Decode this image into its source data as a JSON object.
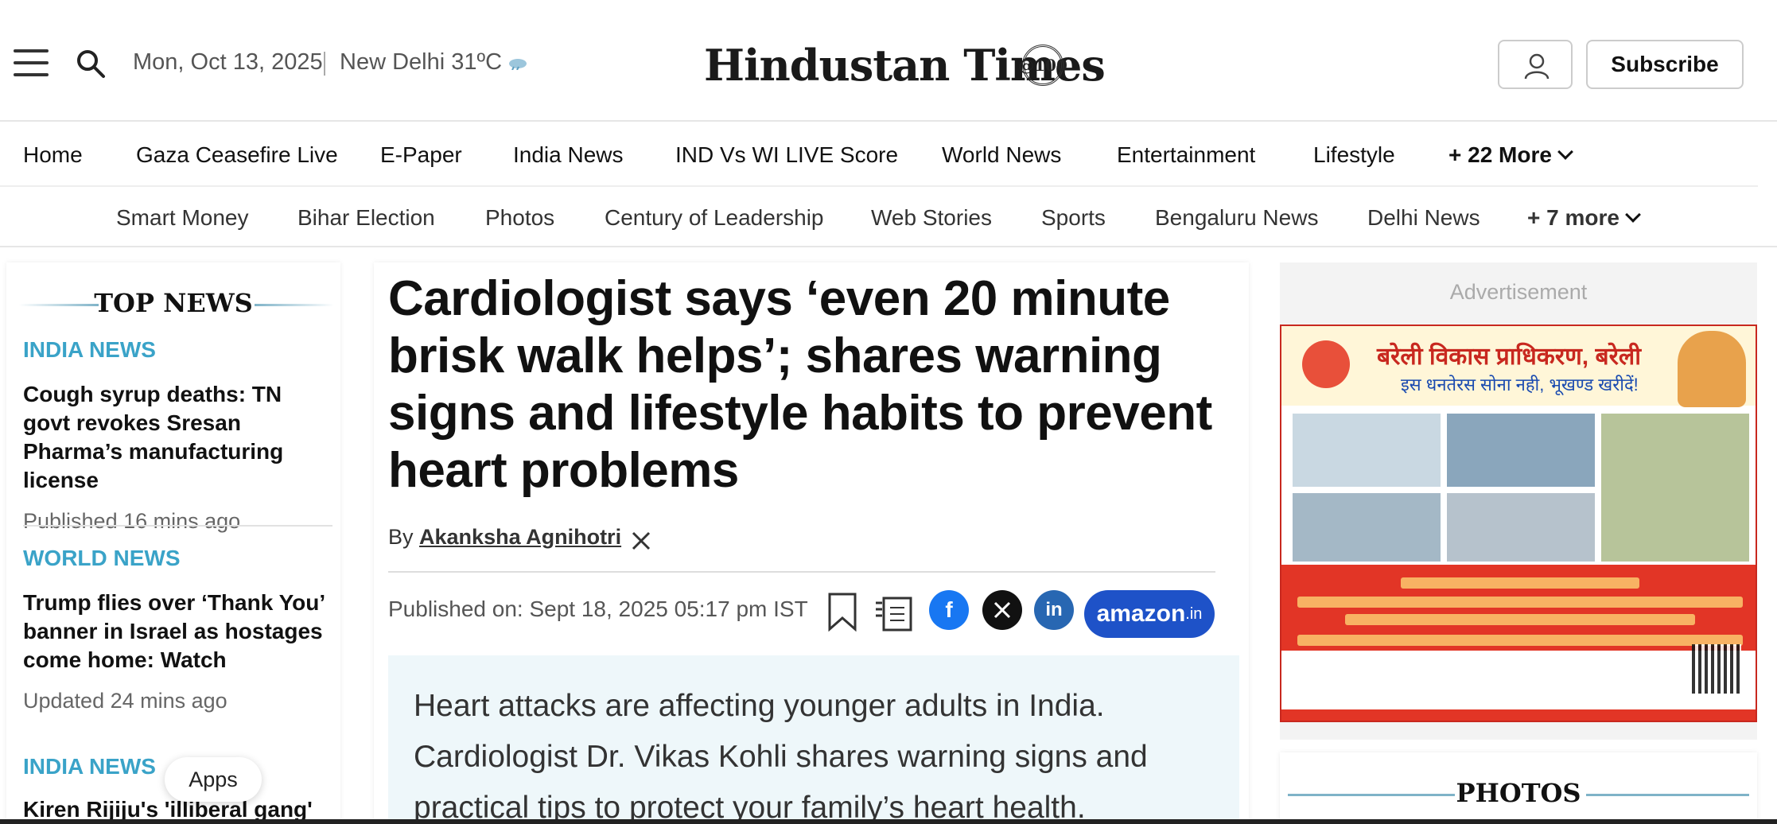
{
  "header": {
    "date": "Mon, Oct 13, 2025",
    "weather": "New Delhi 31ºC",
    "logo_text": "Hindustan Times",
    "logo_badge": "@100",
    "subscribe_label": "Subscribe"
  },
  "nav_primary": [
    {
      "label": "Home"
    },
    {
      "label": "Gaza Ceasefire Live"
    },
    {
      "label": "E-Paper"
    },
    {
      "label": "India News"
    },
    {
      "label": "IND Vs WI LIVE Score"
    },
    {
      "label": "World News"
    },
    {
      "label": "Entertainment"
    },
    {
      "label": "Lifestyle"
    },
    {
      "label": "+ 22 More"
    }
  ],
  "nav_secondary": [
    {
      "label": "Smart Money"
    },
    {
      "label": "Bihar Election"
    },
    {
      "label": "Photos"
    },
    {
      "label": "Century of Leadership"
    },
    {
      "label": "Web Stories"
    },
    {
      "label": "Sports"
    },
    {
      "label": "Bengaluru News"
    },
    {
      "label": "Delhi News"
    },
    {
      "label": "+ 7 more"
    }
  ],
  "top_news": {
    "heading": "TOP NEWS",
    "items": [
      {
        "category": "INDIA NEWS",
        "title": "Cough syrup deaths: TN govt revokes Sresan Pharma’s manufacturing license",
        "time": "Published 16 mins ago"
      },
      {
        "category": "WORLD NEWS",
        "title": "Trump flies over ‘Thank You’ banner in Israel as hostages come home: Watch",
        "time": "Updated 24 mins ago"
      },
      {
        "category": "INDIA NEWS",
        "title": "Kiren Rijiju's 'illiberal gang'",
        "time": ""
      }
    ],
    "apps_label": "Apps"
  },
  "article": {
    "headline": "Cardiologist says ‘even 20 minute brisk walk helps’; shares warning signs and lifestyle habits to prevent heart problems",
    "byline_prefix": "By",
    "author": "Akanksha Agnihotri",
    "published": "Published on: Sept 18, 2025 05:17 pm IST",
    "amazon_label": "amazon",
    "amazon_suffix": ".in",
    "summary": "Heart attacks are affecting younger adults in India. Cardiologist Dr. Vikas Kohli shares warning signs and practical tips to protect your family’s heart health."
  },
  "sidebar": {
    "advertisement_label": "Advertisement",
    "ad_org": "बरेली विकास प्राधिकरण, बरेली",
    "ad_sub": "इस धनतेरस सोना नही, भूखण्ड खरीदें!",
    "photos_heading": "PHOTOS"
  },
  "colors": {
    "accent_blue": "#3aa3c8",
    "facebook": "#1877f2",
    "linkedin": "#2867b2",
    "amazon_btn": "#1e52c8"
  }
}
